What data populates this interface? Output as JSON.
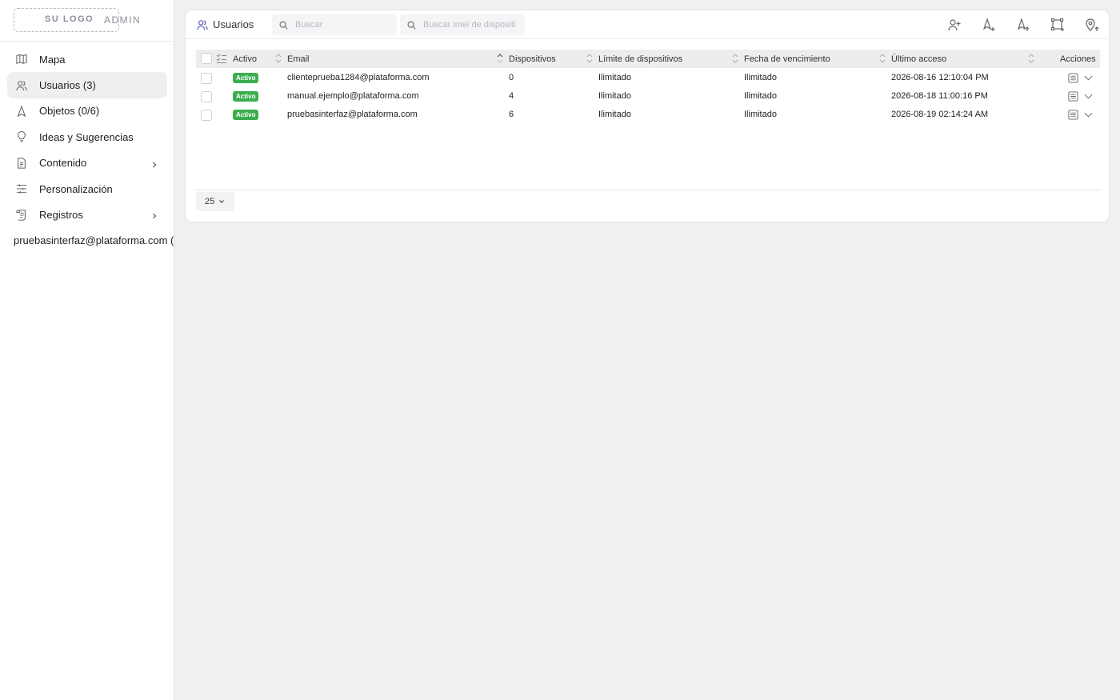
{
  "app": {
    "logo_text": "SU LOGO",
    "admin_text": "ADMIN"
  },
  "sidebar": {
    "items": [
      {
        "label": "Mapa",
        "icon": "map-icon",
        "active": false
      },
      {
        "label": "Usuarios (3)",
        "icon": "users-icon",
        "active": true
      },
      {
        "label": "Objetos (0/6)",
        "icon": "object-icon",
        "active": false
      },
      {
        "label": "Ideas y Sugerencias",
        "icon": "lightbulb-icon",
        "active": false
      },
      {
        "label": "Contenido",
        "icon": "document-icon",
        "active": false,
        "has_submenu": true
      },
      {
        "label": "Personalización",
        "icon": "sliders-icon",
        "active": false
      },
      {
        "label": "Registros",
        "icon": "scroll-icon",
        "active": false,
        "has_submenu": true
      }
    ],
    "user": "pruebasinterfaz@plataforma.com (D"
  },
  "header": {
    "title": "Usuarios",
    "search_placeholder": "Buscar",
    "imei_placeholder": "Buscar imei de dispositi",
    "icons": [
      "add-user-icon",
      "add-object-icon",
      "upload-object-icon",
      "geofence-icon",
      "upload-poi-icon"
    ]
  },
  "table": {
    "columns": {
      "active": "Activo",
      "email": "Email",
      "devices": "Dispositivos",
      "device_limit": "Límite de dispositivos",
      "expiration": "Fecha de vencimiento",
      "last_access": "Último acceso",
      "actions": "Acciones"
    },
    "rows": [
      {
        "status": "Activo",
        "email": "clienteprueba1284@plataforma.com",
        "devices": "0",
        "device_limit": "Ilimitado",
        "expiration": "Ilimitado",
        "last_access": "2026-08-16 12:10:04 PM"
      },
      {
        "status": "Activo",
        "email": "manual.ejemplo@plataforma.com",
        "devices": "4",
        "device_limit": "Ilimitado",
        "expiration": "Ilimitado",
        "last_access": "2026-08-18 11:00:16 PM"
      },
      {
        "status": "Activo",
        "email": "pruebasinterfaz@plataforma.com",
        "devices": "6",
        "device_limit": "Ilimitado",
        "expiration": "Ilimitado",
        "last_access": "2026-08-19 02:14:24 AM"
      }
    ]
  },
  "footer": {
    "per_page": "25"
  },
  "colors": {
    "status_active": "#3cae4f",
    "accent": "#4b4fa8"
  }
}
